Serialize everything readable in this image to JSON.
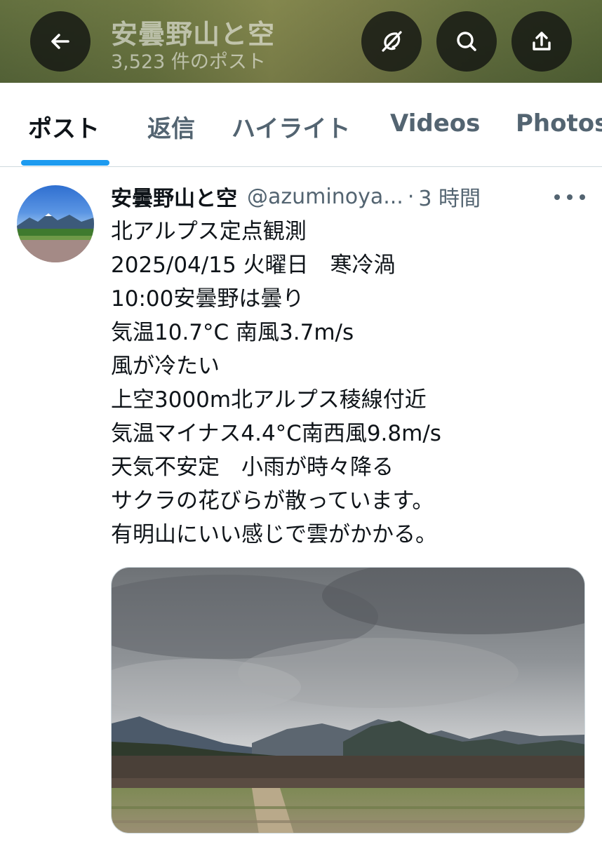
{
  "header": {
    "back_icon": "arrow-left-icon",
    "title": "安曇野山と空",
    "post_count": "3,523 件のポスト",
    "grok_icon": "grok-icon",
    "search_icon": "search-icon",
    "share_icon": "share-icon"
  },
  "tabs": [
    {
      "label": "ポスト",
      "active": true
    },
    {
      "label": "返信",
      "active": false
    },
    {
      "label": "ハイライト",
      "active": false
    },
    {
      "label": "Videos",
      "active": false
    },
    {
      "label": "Photos",
      "active": false
    }
  ],
  "colors": {
    "accent": "#1d9bf0",
    "text_primary": "#0f1419",
    "text_secondary": "#536471"
  },
  "post": {
    "author_name": "安曇野山と空",
    "author_handle": "@azuminoya...",
    "separator": "·",
    "time": "3 時間",
    "more_icon": "more-horizontal-icon",
    "lines": [
      "北アルプス定点観測",
      "2025/04/15 火曜日　寒冷渦",
      "10:00安曇野は曇り",
      "気温10.7°C 南風3.7m/s",
      "風が冷たい",
      "上空3000m北アルプス稜線付近",
      "気温マイナス4.4°C南西風9.8m/s",
      "天気不安定　小雨が時々降る",
      "サクラの花びらが散っています。",
      "有明山にいい感じで雲がかかる。"
    ]
  }
}
